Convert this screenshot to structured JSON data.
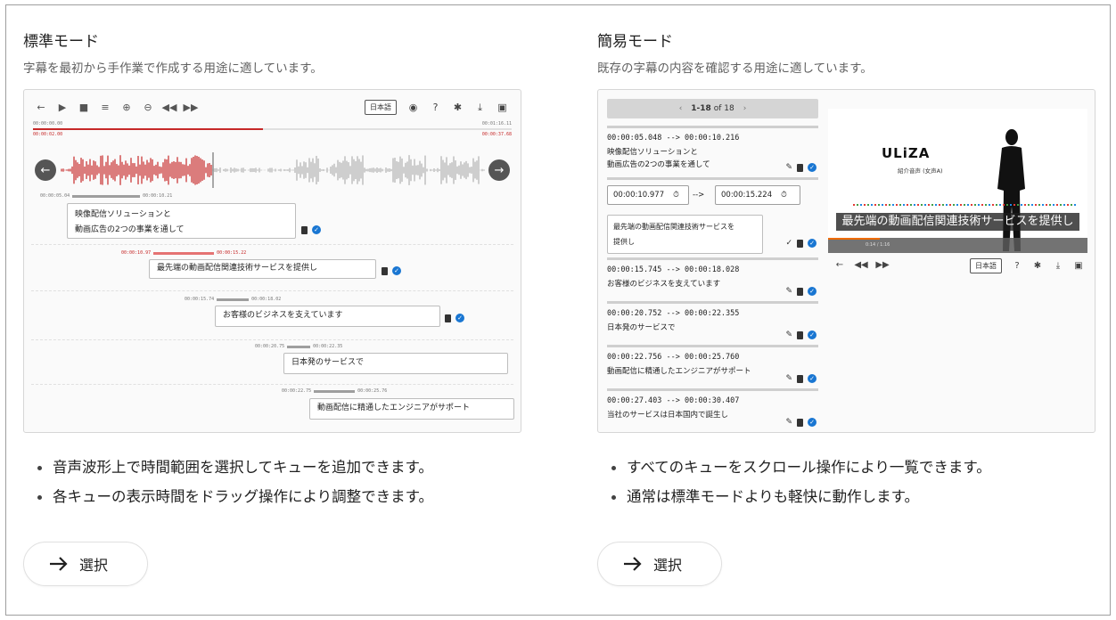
{
  "standard": {
    "title": "標準モード",
    "description": "字幕を最初から手作業で作成する用途に適しています。",
    "bullets": [
      "音声波形上で時間範囲を選択してキューを追加できます。",
      "各キューの表示時間をドラッグ操作により調整できます。"
    ],
    "select_label": "選択",
    "preview": {
      "lang_button": "日本語",
      "time_start": "00:00:00.00",
      "time_end": "00:01:16.11",
      "time_current": "00:00:02.00",
      "time_current_end": "00:00:37.68",
      "progress_fraction": 0.48,
      "cues": [
        {
          "start": "00:00:05.04",
          "end": "00:00:10.21",
          "line1": "映像配信ソリューションと",
          "line2": "動画広告の2つの事業を通して",
          "highlight": false
        },
        {
          "start": "00:00:10.97",
          "end": "00:00:15.22",
          "line1": "最先端の動画配信関連技術サービスを提供し",
          "line2": "",
          "highlight": true
        },
        {
          "start": "00:00:15.74",
          "end": "00:00:18.02",
          "line1": "お客様のビジネスを支えています",
          "line2": "",
          "highlight": false
        },
        {
          "start": "00:00:20.75",
          "end": "00:00:22.35",
          "line1": "日本発のサービスで",
          "line2": "",
          "highlight": false
        },
        {
          "start": "00:00:22.75",
          "end": "00:00:25.76",
          "line1": "動画配信に精通したエンジニアがサポート",
          "line2": "",
          "highlight": false
        }
      ]
    }
  },
  "simple": {
    "title": "簡易モード",
    "description": "既存の字幕の内容を確認する用途に適しています。",
    "bullets": [
      "すべてのキューをスクロール操作により一覧できます。",
      "通常は標準モードよりも軽快に動作します。"
    ],
    "select_label": "選択",
    "preview": {
      "pager_range": "1-18",
      "pager_of": "of 18",
      "lang_button": "日本語",
      "cue1": {
        "times": "00:00:05.048 --> 00:00:10.216",
        "line1": "映像配信ソリューションと",
        "line2": "動画広告の2つの事業を通して"
      },
      "edit_cue": {
        "start": "00:00:10.977",
        "end": "00:00:15.224",
        "arrow": "-->",
        "line1": "最先端の動画配信関連技術サービスを",
        "line2": "提供し"
      },
      "cues": [
        {
          "times": "00:00:15.745 --> 00:00:18.028",
          "text": "お客様のビジネスを支えています"
        },
        {
          "times": "00:00:20.752 --> 00:00:22.355",
          "text": "日本発のサービスで"
        },
        {
          "times": "00:00:22.756 --> 00:00:25.760",
          "text": "動画配信に精通したエンジニアがサポート"
        },
        {
          "times": "00:00:27.403 --> 00:00:30.407",
          "text": "当社のサービスは日本国内で誕生し"
        }
      ],
      "video_logo": "ULiZA",
      "video_logo_sub": "紹介音声 (女声A)",
      "video_subtitle": "最先端の動画配信関連技術サービスを提供し",
      "video_time": "0:14 / 1:16"
    }
  }
}
